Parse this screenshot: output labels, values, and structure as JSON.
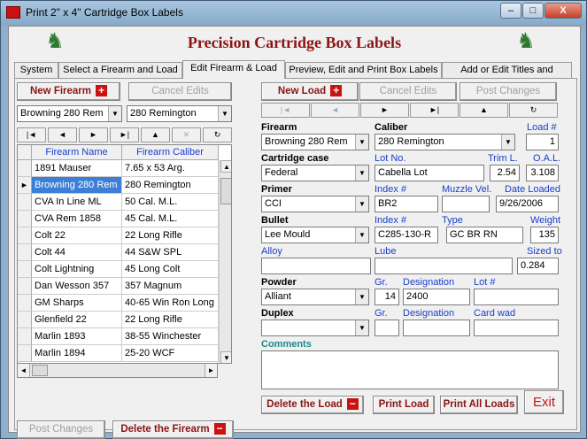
{
  "window": {
    "title": "Print 2\" x 4\" Cartridge Box Labels",
    "min": "–",
    "max": "□",
    "close": "X"
  },
  "header": {
    "title": "Precision Cartridge Box Labels"
  },
  "tabs": [
    "System",
    "Select a Firearm and Load",
    "Edit Firearm & Load",
    "Preview, Edit and Print Box Labels",
    "Add or Edit Titles and Names"
  ],
  "left": {
    "new_firearm": "New Firearm",
    "cancel_edits": "Cancel Edits",
    "firearm_combo": "Browning 280 Rem",
    "caliber_combo": "280 Remington",
    "nav": [
      "|◄",
      "◄",
      "►",
      "►|",
      "▲",
      "✕",
      "↻"
    ],
    "grid": {
      "headers": [
        "Firearm Name",
        "Firearm Caliber"
      ],
      "rows": [
        [
          "1891 Mauser",
          "7.65 x 53 Arg."
        ],
        [
          "Browning 280 Rem",
          "280 Remington"
        ],
        [
          "CVA In Line ML",
          "50 Cal. M.L."
        ],
        [
          "CVA Rem 1858",
          "45 Cal. M.L."
        ],
        [
          "Colt 22",
          "22 Long Rifle"
        ],
        [
          "Colt 44",
          "44 S&W SPL"
        ],
        [
          "Colt Lightning",
          "45 Long Colt"
        ],
        [
          "Dan Wesson 357",
          "357 Magnum"
        ],
        [
          "GM Sharps",
          "40-65 Win Ron Long"
        ],
        [
          "Glenfield 22",
          "22 Long Rifle"
        ],
        [
          "Marlin 1893",
          "38-55 Winchester"
        ],
        [
          "Marlin 1894",
          "25-20 WCF"
        ]
      ],
      "selected_index": 1
    },
    "post_changes": "Post Changes",
    "delete_firearm": "Delete the Firearm"
  },
  "right": {
    "new_load": "New Load",
    "cancel_edits": "Cancel Edits",
    "post_changes": "Post Changes",
    "nav": [
      "|◄",
      "◄",
      "►",
      "►|",
      "▲",
      "↻"
    ],
    "labels": {
      "firearm": "Firearm",
      "caliber": "Caliber",
      "load_no": "Load #",
      "case": "Cartridge case",
      "lot_no": "Lot No.",
      "trim": "Trim L.",
      "oal": "O.A.L.",
      "primer": "Primer",
      "index": "Index #",
      "muzzle": "Muzzle Vel.",
      "date": "Date Loaded",
      "bullet": "Bullet",
      "index2": "Index #",
      "type": "Type",
      "weight": "Weight",
      "alloy": "Alloy",
      "lube": "Lube",
      "sized": "Sized to",
      "powder": "Powder",
      "gr": "Gr.",
      "designation": "Designation",
      "lot2": "Lot #",
      "duplex": "Duplex",
      "gr2": "Gr.",
      "designation2": "Designation",
      "card_wad": "Card wad",
      "comments": "Comments"
    },
    "values": {
      "firearm": "Browning 280 Rem",
      "caliber": "280 Remington",
      "load_no": "1",
      "case": "Federal",
      "lot_no": "Cabella Lot",
      "trim": "2.54",
      "oal": "3.108",
      "primer": "CCI",
      "primer_index": "BR2",
      "muzzle": "",
      "date": "9/26/2006",
      "bullet": "Lee Mould",
      "bullet_index": "C285-130-R",
      "type": "GC BR RN",
      "weight": "135",
      "alloy": "",
      "lube": "",
      "sized": "0.284",
      "powder": "Alliant",
      "powder_gr": "14",
      "powder_designation": "2400",
      "powder_lot": "",
      "duplex": "",
      "duplex_gr": "",
      "duplex_designation": "",
      "card_wad": "",
      "comments": ""
    },
    "delete_load": "Delete the Load",
    "print_load": "Print Load",
    "print_all": "Print All Loads",
    "exit": "Exit"
  }
}
